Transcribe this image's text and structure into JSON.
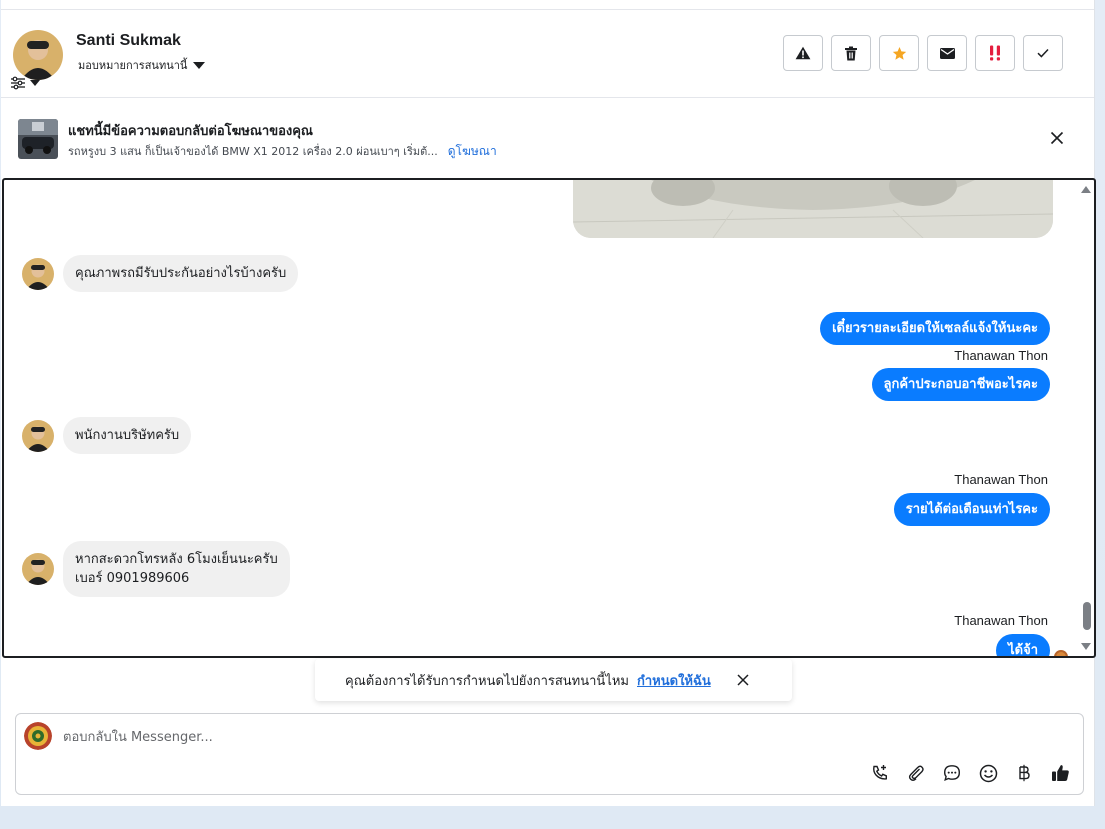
{
  "header": {
    "contact_name": "Santi Sukmak",
    "assign_label": "มอบหมายการสนทนานี้",
    "actions": [
      {
        "name": "report-button",
        "icon": "warning-icon"
      },
      {
        "name": "delete-button",
        "icon": "trash-icon"
      },
      {
        "name": "star-button",
        "icon": "star-icon"
      },
      {
        "name": "mark-unread-button",
        "icon": "envelope-icon"
      },
      {
        "name": "spam-button",
        "icon": "double-exclamation-icon"
      },
      {
        "name": "done-button",
        "icon": "checkmark-icon"
      }
    ]
  },
  "ad": {
    "title": "แชทนี้มีข้อความตอบกลับต่อโฆษณาของคุณ",
    "subtitle": "รถหรูงบ 3 แสน ก็เป็นเจ้าของได้ BMW X1 2012 เครื่อง 2.0 ผ่อนเบาๆ เริ่มต้...",
    "link": "ดูโฆษณา"
  },
  "messages": {
    "m1": "คุณภาพรถมีรับประกันอย่างไรบ้างครับ",
    "m2": "เดี๋ยวรายละเอียดให้เซลล์แจ้งให้นะคะ",
    "sender": "Thanawan Thon",
    "m3": "ลูกค้าประกอบอาชีพอะไรคะ",
    "m4": "พนักงานบริษัทครับ",
    "m5": "รายได้ต่อเดือนเท่าไรคะ",
    "m6_line1": "หากสะดวกโทรหลัง 6โมงเย็นนะครับ",
    "m6_line2": "เบอร์ 0901989606",
    "m7": "ได้จ้า"
  },
  "toast": {
    "text": "คุณต้องการได้รับการกำหนดไปยังการสนทนานี้ไหม",
    "link": "กำหนดให้ฉัน"
  },
  "composer": {
    "placeholder": "ตอบกลับใน Messenger...",
    "tools": [
      "call-icon",
      "attachment-icon",
      "saved-reply-icon",
      "emoji-icon",
      "baht-icon",
      "like-icon"
    ]
  },
  "colors": {
    "accent": "#0a7cff",
    "link": "#216fdb",
    "star": "#f5a623",
    "spam": "#e41e3f"
  }
}
